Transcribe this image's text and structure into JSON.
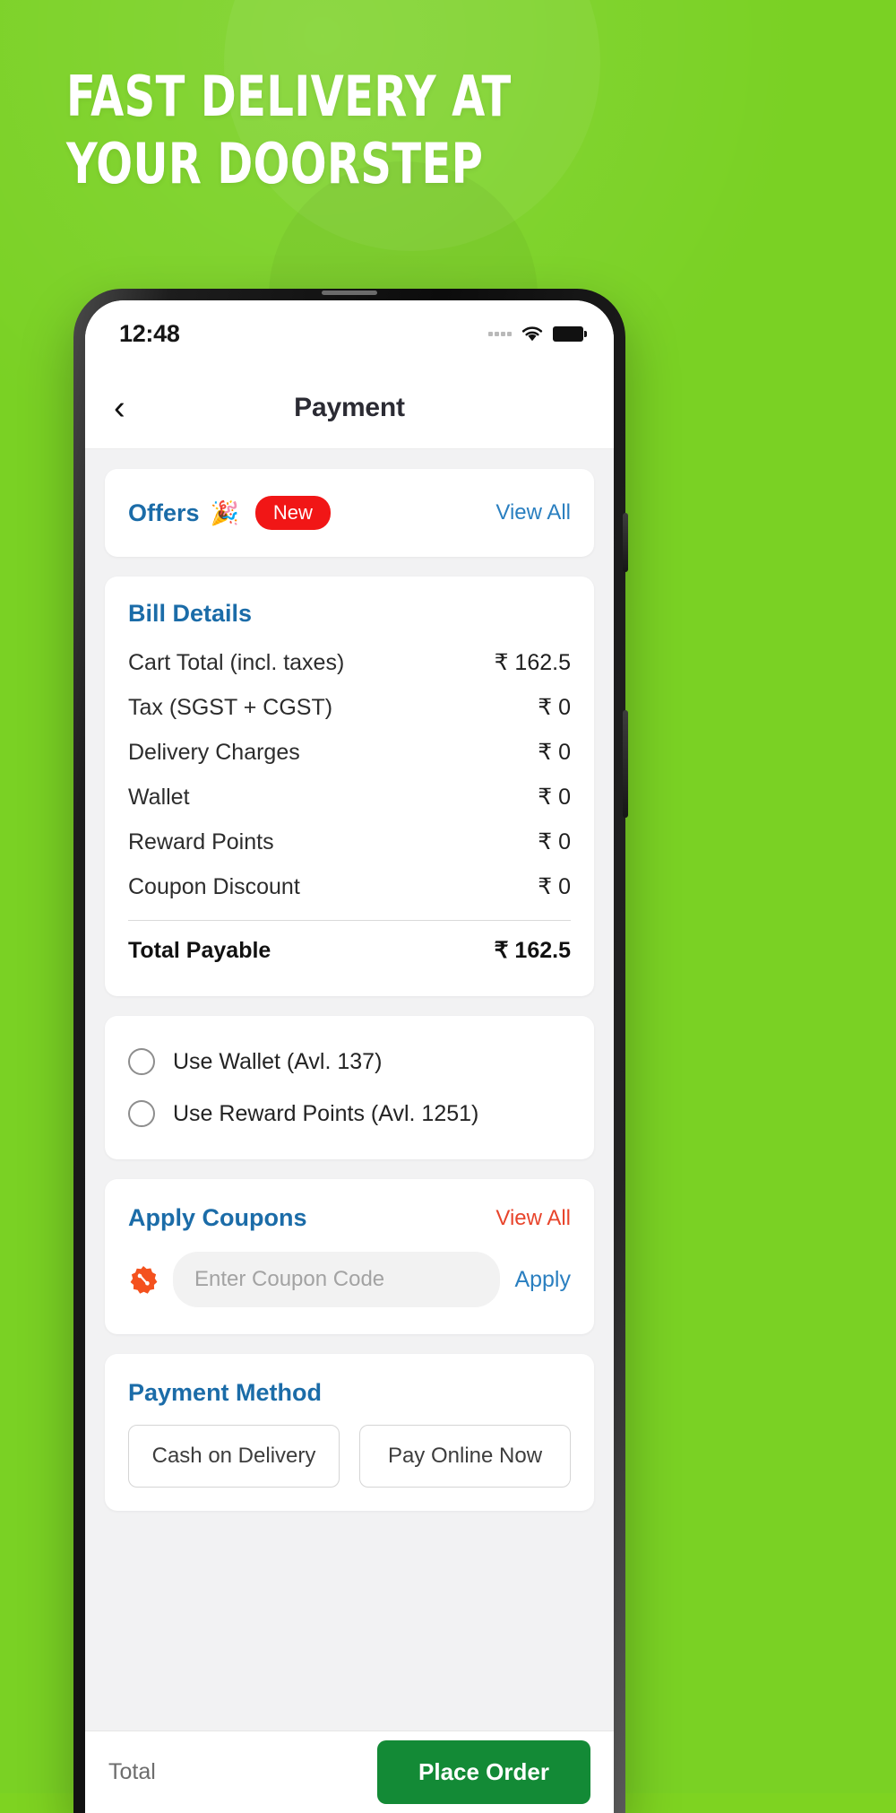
{
  "promo": {
    "headline": "FAST DELIVERY AT YOUR DOORSTEP",
    "background_color": "#7ad124"
  },
  "phone": {
    "statusbar": {
      "time": "12:48",
      "signal_icon": "signal-dots-icon",
      "wifi_icon": "wifi-icon",
      "battery_icon": "battery-full-icon"
    },
    "appbar": {
      "back_icon": "chevron-left-icon",
      "title": "Payment"
    },
    "offers": {
      "title": "Offers",
      "emoji": "🎉",
      "badge": "New",
      "view_all": "View All",
      "badge_color": "#f11616",
      "title_color": "#1b6ca8"
    },
    "bill": {
      "title": "Bill Details",
      "rows": [
        {
          "label": "Cart Total (incl. taxes)",
          "amount": "₹ 162.5"
        },
        {
          "label": "Tax (SGST + CGST)",
          "amount": "₹ 0"
        },
        {
          "label": "Delivery Charges",
          "amount": "₹ 0"
        },
        {
          "label": "Wallet",
          "amount": "₹ 0"
        },
        {
          "label": "Reward Points",
          "amount": "₹ 0"
        },
        {
          "label": "Coupon Discount",
          "amount": "₹ 0"
        }
      ],
      "total_label": "Total Payable",
      "total_amount": "₹ 162.5"
    },
    "toggles": [
      {
        "label": "Use Wallet (Avl. 137)",
        "selected": false
      },
      {
        "label": "Use Reward Points (Avl. 1251)",
        "selected": false
      }
    ],
    "coupons": {
      "title": "Apply Coupons",
      "view_all": "View All",
      "view_all_color": "#e8452c",
      "coupon_icon": "🏷",
      "input_placeholder": "Enter Coupon Code",
      "input_value": "",
      "apply_label": "Apply"
    },
    "payment_method": {
      "title": "Payment Method",
      "options": [
        {
          "label": "Cash on Delivery",
          "selected": false
        },
        {
          "label": "Pay Online Now",
          "selected": false
        }
      ]
    },
    "bottom_bar": {
      "total_label": "Total",
      "place_order_label": "Place Order",
      "button_color": "#138a36"
    }
  }
}
